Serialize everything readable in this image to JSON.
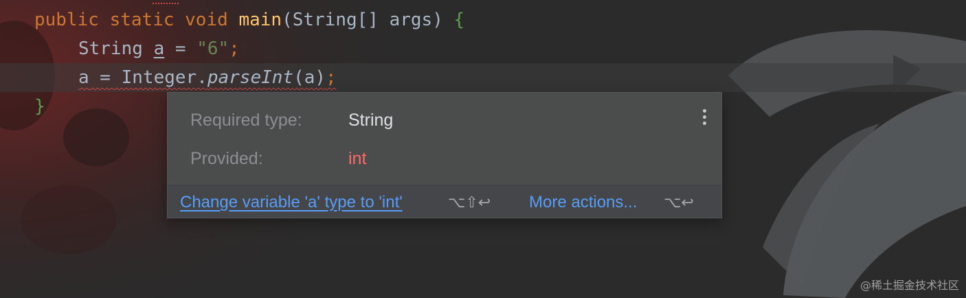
{
  "code": {
    "line1": {
      "public_kw": "public",
      "static_kw": "static",
      "void_kw": "void",
      "method_name": "main",
      "params": "(String[] args)",
      "open_brace": "{"
    },
    "line2": {
      "type": "String",
      "var_name": "a",
      "assign": " = ",
      "string_literal": "\"6\"",
      "semicolon": ";"
    },
    "line3": {
      "var_name": "a",
      "assign": " = Integer.",
      "method": "parseInt",
      "args": "(a)",
      "semicolon": ";"
    },
    "line4": {
      "close_brace": "}"
    }
  },
  "popup": {
    "required_label": "Required type:",
    "required_value": "String",
    "provided_label": "Provided:",
    "provided_value": "int",
    "quick_fix_label": "Change variable 'a' type to 'int'",
    "quick_fix_shortcut": "⌥⇧↩",
    "more_actions_label": "More actions...",
    "more_actions_shortcut": "⌥↩",
    "menu_icon": "kebab-vertical-icon"
  },
  "watermark": "@稀土掘金技术社区",
  "colors": {
    "keyword": "#cc7832",
    "method": "#ffc66d",
    "string": "#6a8759",
    "error": "#ff6b68",
    "link": "#589df6",
    "popup_bg": "#4b4d4d"
  }
}
